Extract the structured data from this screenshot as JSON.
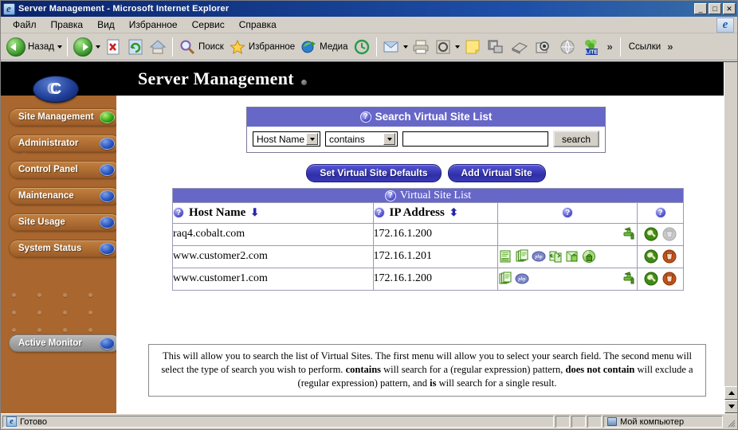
{
  "window": {
    "title": "Server Management - Microsoft Internet Explorer",
    "app_icon": "ie-icon",
    "minimize_label": "_",
    "maximize_label": "□",
    "close_label": "✕"
  },
  "menu": {
    "items": [
      {
        "label": "Файл"
      },
      {
        "label": "Правка"
      },
      {
        "label": "Вид"
      },
      {
        "label": "Избранное"
      },
      {
        "label": "Сервис"
      },
      {
        "label": "Справка"
      }
    ]
  },
  "toolbar": {
    "back_label": "Назад",
    "search_label": "Поиск",
    "favorites_label": "Избранное",
    "media_label": "Медиа",
    "links_label": "Ссылки",
    "overflow_label": "»",
    "links_overflow_label": "»",
    "icons": [
      "back-icon",
      "forward-icon",
      "stop-icon",
      "refresh-icon",
      "home-icon",
      "search-icon",
      "favorites-icon",
      "media-icon",
      "history-icon",
      "mail-icon",
      "print-icon",
      "edit-icon",
      "notes-icon",
      "messenger-icon",
      "encyclopedia-icon",
      "research-icon",
      "globe-icon",
      "lite-icon"
    ]
  },
  "banner": {
    "title": "Server Management",
    "logo_letter": "C"
  },
  "sidebar": {
    "items": [
      {
        "label": "Site Management",
        "state": "active",
        "indicator": "green"
      },
      {
        "label": "Administrator",
        "state": "normal",
        "indicator": "blue"
      },
      {
        "label": "Control Panel",
        "state": "normal",
        "indicator": "blue"
      },
      {
        "label": "Maintenance",
        "state": "normal",
        "indicator": "blue"
      },
      {
        "label": "Site Usage",
        "state": "normal",
        "indicator": "blue"
      },
      {
        "label": "System Status",
        "state": "normal",
        "indicator": "blue"
      }
    ],
    "active_monitor": {
      "label": "Active Monitor",
      "indicator": "blue"
    }
  },
  "search_panel": {
    "title": "Search Virtual Site List",
    "help_icon": "help-icon",
    "field_select": {
      "value": "Host Name",
      "options": [
        "Host Name",
        "IP Address"
      ]
    },
    "operator_select": {
      "value": "contains",
      "options": [
        "contains",
        "does not contain",
        "is"
      ]
    },
    "query_input": {
      "value": "",
      "placeholder": ""
    },
    "search_button": "search"
  },
  "actions": {
    "set_defaults": "Set Virtual Site Defaults",
    "add_site": "Add Virtual Site"
  },
  "site_list": {
    "title": "Virtual Site List",
    "columns": [
      {
        "label": "Host Name",
        "sort": "⬇",
        "help_icon": "help-icon"
      },
      {
        "label": "IP Address",
        "sort": "⬍",
        "help_icon": "help-icon"
      },
      {
        "label": "",
        "help_icon": "help-icon"
      },
      {
        "label": "",
        "help_icon": "help-icon"
      }
    ],
    "rows": [
      {
        "host_name": "raq4.cobalt.com",
        "ip_address": "172.16.1.200",
        "service_icons": [
          "faucet-icon"
        ],
        "action_icons": [
          "wrench-icon",
          "trash-icon-disabled"
        ]
      },
      {
        "host_name": "www.customer2.com",
        "ip_address": "172.16.1.201",
        "service_icons": [
          "cgi-icon",
          "pages-icon",
          "php-icon",
          "transfer-icon",
          "ssl-icon",
          "secure-icon"
        ],
        "action_icons": [
          "wrench-icon",
          "trash-icon"
        ]
      },
      {
        "host_name": "www.customer1.com",
        "ip_address": "172.16.1.200",
        "service_icons": [
          "pages-icon",
          "php-icon",
          "faucet-icon"
        ],
        "action_icons": [
          "wrench-icon",
          "trash-icon"
        ]
      }
    ]
  },
  "help_text": {
    "part1": "This will allow you to search the list of Virtual Sites. The first menu will allow you to select your search field. The second menu will select the type of search you wish to perform. ",
    "bold1": "contains",
    "part2": " will search for a (regular expression) pattern, ",
    "bold2": "does not contain",
    "part3": " will exclude a (regular expression) pattern, and ",
    "bold3": "is",
    "part4": " will search for a single result."
  },
  "status_bar": {
    "ready_label": "Готово",
    "zone_label": "Мой компьютер"
  },
  "colors": {
    "titlebar": "#0a246a",
    "panel_header": "#6767c8",
    "sidebar": "#a9662e",
    "pill": "#3a3ab8",
    "chrome": "#d4d0c8"
  }
}
